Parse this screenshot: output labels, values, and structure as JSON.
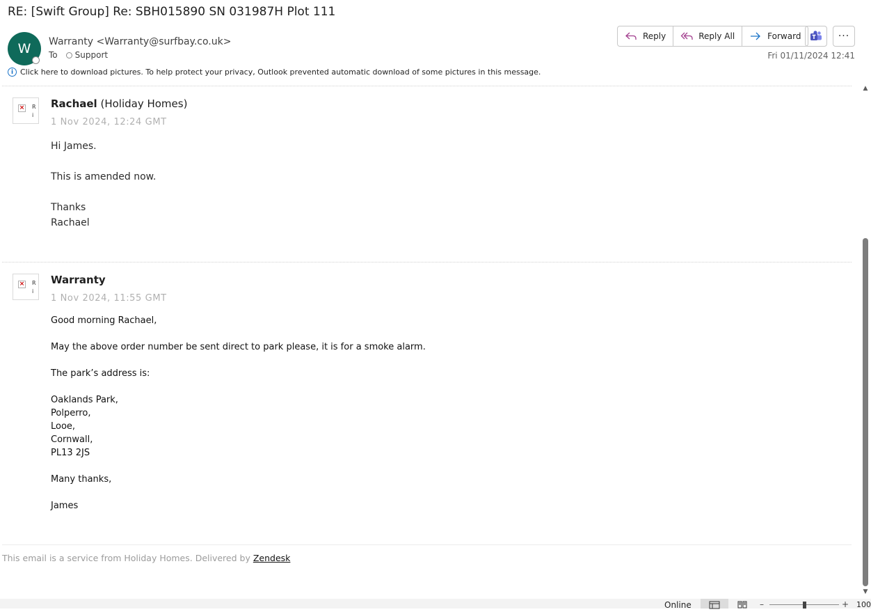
{
  "header": {
    "subject": "RE: [Swift Group] Re: SBH015890 SN 031987H Plot 111",
    "avatar_initial": "W",
    "sender": "Warranty <Warranty@surfbay.co.uk>",
    "to_label": "To",
    "to_recipient": "Support",
    "date": "Fri 01/11/2024 12:41",
    "avatar_color": "#0f6a5a"
  },
  "toolbar": {
    "reply_label": "Reply",
    "reply_all_label": "Reply All",
    "forward_label": "Forward",
    "more_label": "···"
  },
  "infobar": {
    "icon": "i",
    "text": "Click here to download pictures. To help protect your privacy, Outlook prevented automatic download of some pictures in this message."
  },
  "messages": [
    {
      "author": "Rachael",
      "org": "(Holiday Homes)",
      "timestamp": "1 Nov 2024, 12:24 GMT",
      "img_alt": "R i",
      "lines": [
        "Hi James.",
        "This is amended now.",
        "Thanks",
        "Rachael"
      ]
    },
    {
      "author": "Warranty",
      "org": "",
      "timestamp": "1 Nov 2024, 11:55 GMT",
      "img_alt": "R i",
      "lines": [
        "Good morning Rachael,",
        "May the above order number be sent direct to park please, it is for a smoke alarm.",
        "The park’s address is:",
        "Oaklands Park,",
        "Polperro,",
        "Looe,",
        "Cornwall,",
        "PL13 2JS",
        "Many thanks,",
        "James"
      ]
    }
  ],
  "footer": {
    "text": "This email is a service from Holiday Homes. Delivered by ",
    "link": "Zendesk"
  },
  "statusbar": {
    "status": "Online",
    "zoom_minus": "–",
    "zoom_plus": "+",
    "zoom": "100%"
  }
}
